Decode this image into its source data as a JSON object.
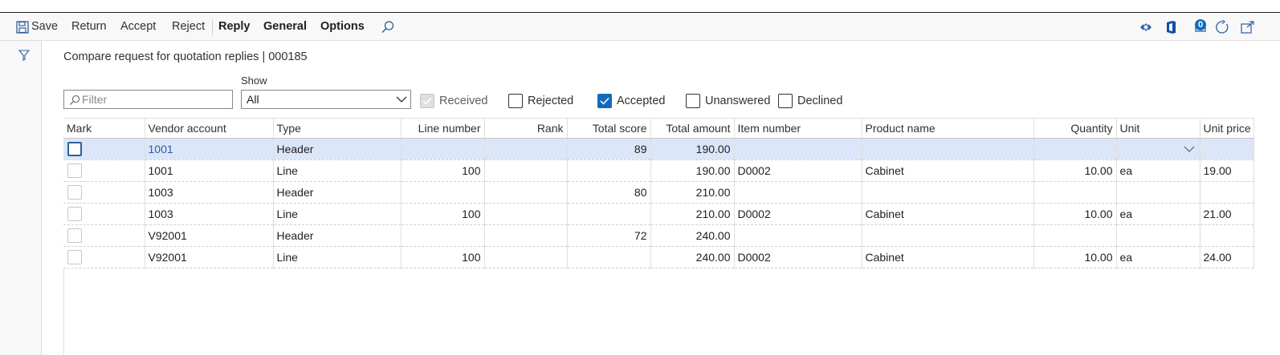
{
  "toolbar": {
    "save": "Save",
    "return": "Return",
    "accept": "Accept",
    "reject": "Reject",
    "reply": "Reply",
    "general": "General",
    "options": "Options",
    "search_icon": "search-icon",
    "notification_count": "0",
    "right_icons": [
      "diamond-arrows-icon",
      "office-icon",
      "notification-icon",
      "refresh-icon",
      "popout-icon"
    ]
  },
  "page": {
    "title": "Compare request for quotation replies  |  000185"
  },
  "filters": {
    "filter_placeholder": "Filter",
    "show_label": "Show",
    "show_value": "All",
    "received": {
      "label": "Received",
      "checked": true,
      "disabled": true
    },
    "rejected": {
      "label": "Rejected",
      "checked": false
    },
    "accepted": {
      "label": "Accepted",
      "checked": true
    },
    "unanswered": {
      "label": "Unanswered",
      "checked": false
    },
    "declined": {
      "label": "Declined",
      "checked": false
    }
  },
  "grid": {
    "columns": [
      "Mark",
      "Vendor account",
      "Type",
      "Line number",
      "Rank",
      "Total score",
      "Total amount",
      "Item number",
      "Product name",
      "Quantity",
      "Unit",
      "Unit price"
    ],
    "rows": [
      {
        "vendor": "1001",
        "type": "Header",
        "line": "",
        "rank": "",
        "score": "89",
        "amount": "190.00",
        "item": "",
        "product": "",
        "qty": "",
        "unit": "",
        "price": ""
      },
      {
        "vendor": "1001",
        "type": "Line",
        "line": "100",
        "rank": "",
        "score": "",
        "amount": "190.00",
        "item": "D0002",
        "product": "Cabinet",
        "qty": "10.00",
        "unit": "ea",
        "price": "19.00"
      },
      {
        "vendor": "1003",
        "type": "Header",
        "line": "",
        "rank": "",
        "score": "80",
        "amount": "210.00",
        "item": "",
        "product": "",
        "qty": "",
        "unit": "",
        "price": ""
      },
      {
        "vendor": "1003",
        "type": "Line",
        "line": "100",
        "rank": "",
        "score": "",
        "amount": "210.00",
        "item": "D0002",
        "product": "Cabinet",
        "qty": "10.00",
        "unit": "ea",
        "price": "21.00"
      },
      {
        "vendor": "V92001",
        "type": "Header",
        "line": "",
        "rank": "",
        "score": "72",
        "amount": "240.00",
        "item": "",
        "product": "",
        "qty": "",
        "unit": "",
        "price": ""
      },
      {
        "vendor": "V92001",
        "type": "Line",
        "line": "100",
        "rank": "",
        "score": "",
        "amount": "240.00",
        "item": "D0002",
        "product": "Cabinet",
        "qty": "10.00",
        "unit": "ea",
        "price": "24.00"
      }
    ]
  },
  "colors": {
    "accent": "#0f6cbd",
    "selected_row": "#dbe6f8",
    "link": "#2c5d9e"
  }
}
